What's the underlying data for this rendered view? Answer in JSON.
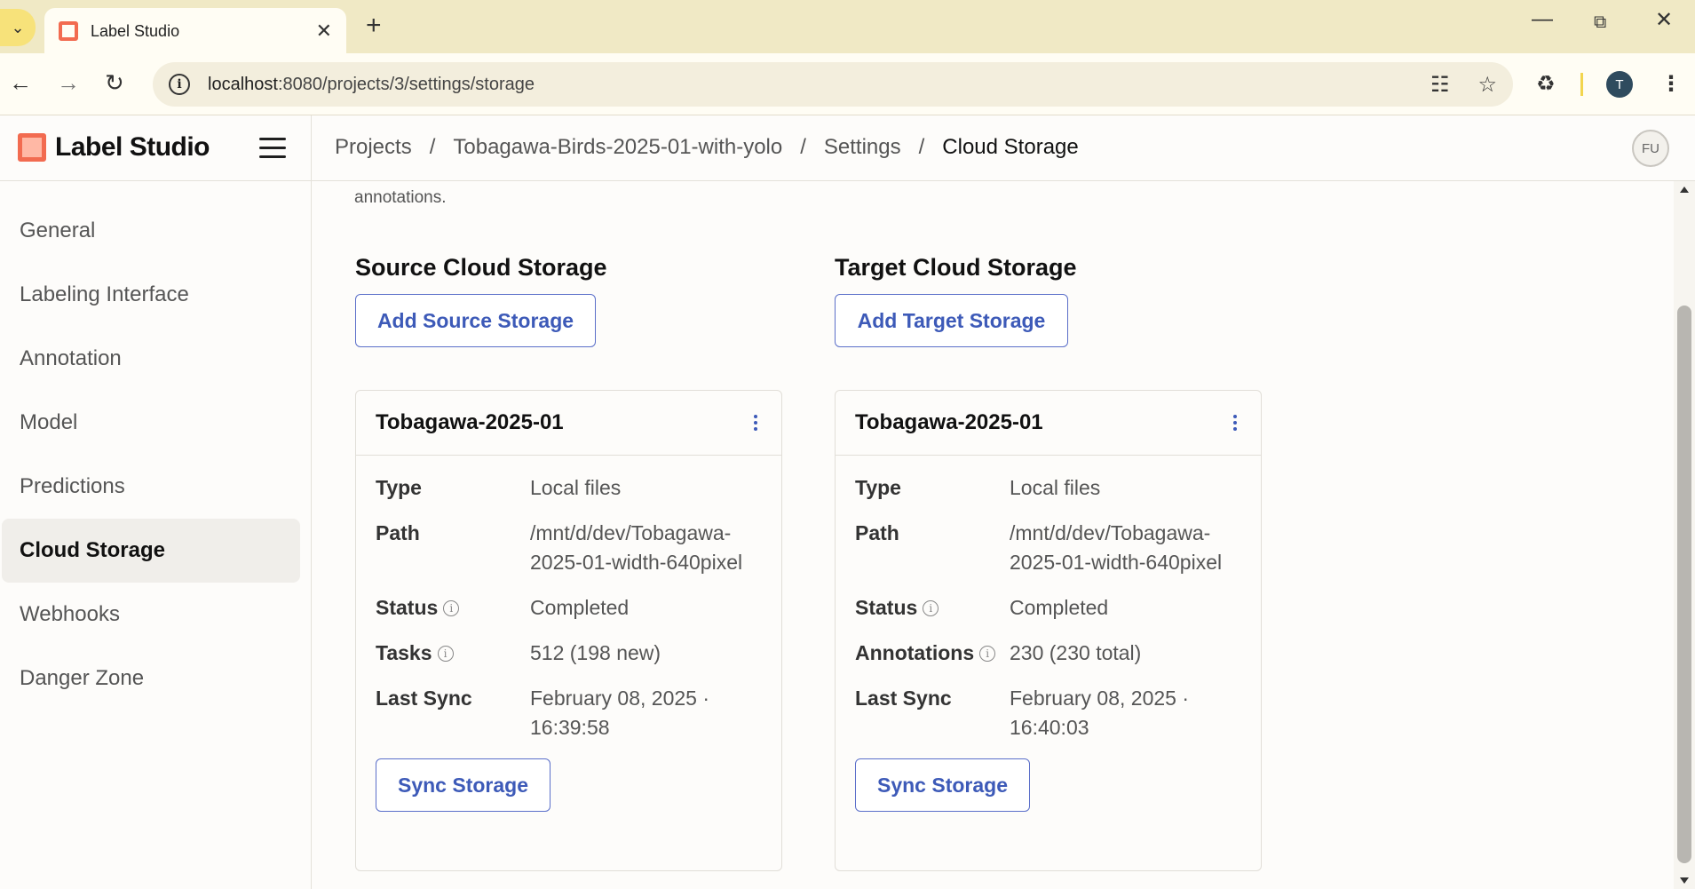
{
  "browser": {
    "tab_title": "Label Studio",
    "url_host": "localhost",
    "url_path": ":8080/projects/3/settings/storage",
    "profile_initial": "T"
  },
  "header": {
    "logo_text": "Label Studio",
    "breadcrumb": [
      "Projects",
      "Tobagawa-Birds-2025-01-with-yolo",
      "Settings",
      "Cloud Storage"
    ],
    "avatar_initials": "FU"
  },
  "sidebar": {
    "items": [
      {
        "label": "General",
        "active": false
      },
      {
        "label": "Labeling Interface",
        "active": false
      },
      {
        "label": "Annotation",
        "active": false
      },
      {
        "label": "Model",
        "active": false
      },
      {
        "label": "Predictions",
        "active": false
      },
      {
        "label": "Cloud Storage",
        "active": true
      },
      {
        "label": "Webhooks",
        "active": false
      },
      {
        "label": "Danger Zone",
        "active": false
      }
    ]
  },
  "main": {
    "intro_tail": "annotations.",
    "source": {
      "title": "Source Cloud Storage",
      "add_label": "Add Source Storage",
      "card": {
        "name": "Tobagawa-2025-01",
        "type_label": "Type",
        "type_value": "Local files",
        "path_label": "Path",
        "path_value": "/mnt/d/dev/Tobagawa-2025-01-width-640pixel",
        "status_label": "Status",
        "status_value": "Completed",
        "count_label": "Tasks",
        "count_value": "512 (198 new)",
        "sync_label": "Last Sync",
        "sync_value_date": "February 08, 2025 ·",
        "sync_value_time": "16:39:58",
        "button": "Sync Storage"
      }
    },
    "target": {
      "title": "Target Cloud Storage",
      "add_label": "Add Target Storage",
      "card": {
        "name": "Tobagawa-2025-01",
        "type_label": "Type",
        "type_value": "Local files",
        "path_label": "Path",
        "path_value": "/mnt/d/dev/Tobagawa-2025-01-width-640pixel",
        "status_label": "Status",
        "status_value": "Completed",
        "count_label": "Annotations",
        "count_value": "230 (230 total)",
        "sync_label": "Last Sync",
        "sync_value_date": "February 08, 2025 ·",
        "sync_value_time": "16:40:03",
        "button": "Sync Storage"
      }
    }
  },
  "colors": {
    "accent": "#3d5ab8",
    "brand": "#f26b50",
    "tabstrip": "#f0e9c5"
  },
  "icons": [
    "chevron-down-icon",
    "close-icon",
    "plus-icon",
    "minimize-icon",
    "restore-icon",
    "back-icon",
    "forward-icon",
    "reload-icon",
    "info-icon",
    "translate-icon",
    "star-icon",
    "extensions-icon",
    "menu-dots-icon",
    "hamburger-icon",
    "kebab-icon"
  ]
}
